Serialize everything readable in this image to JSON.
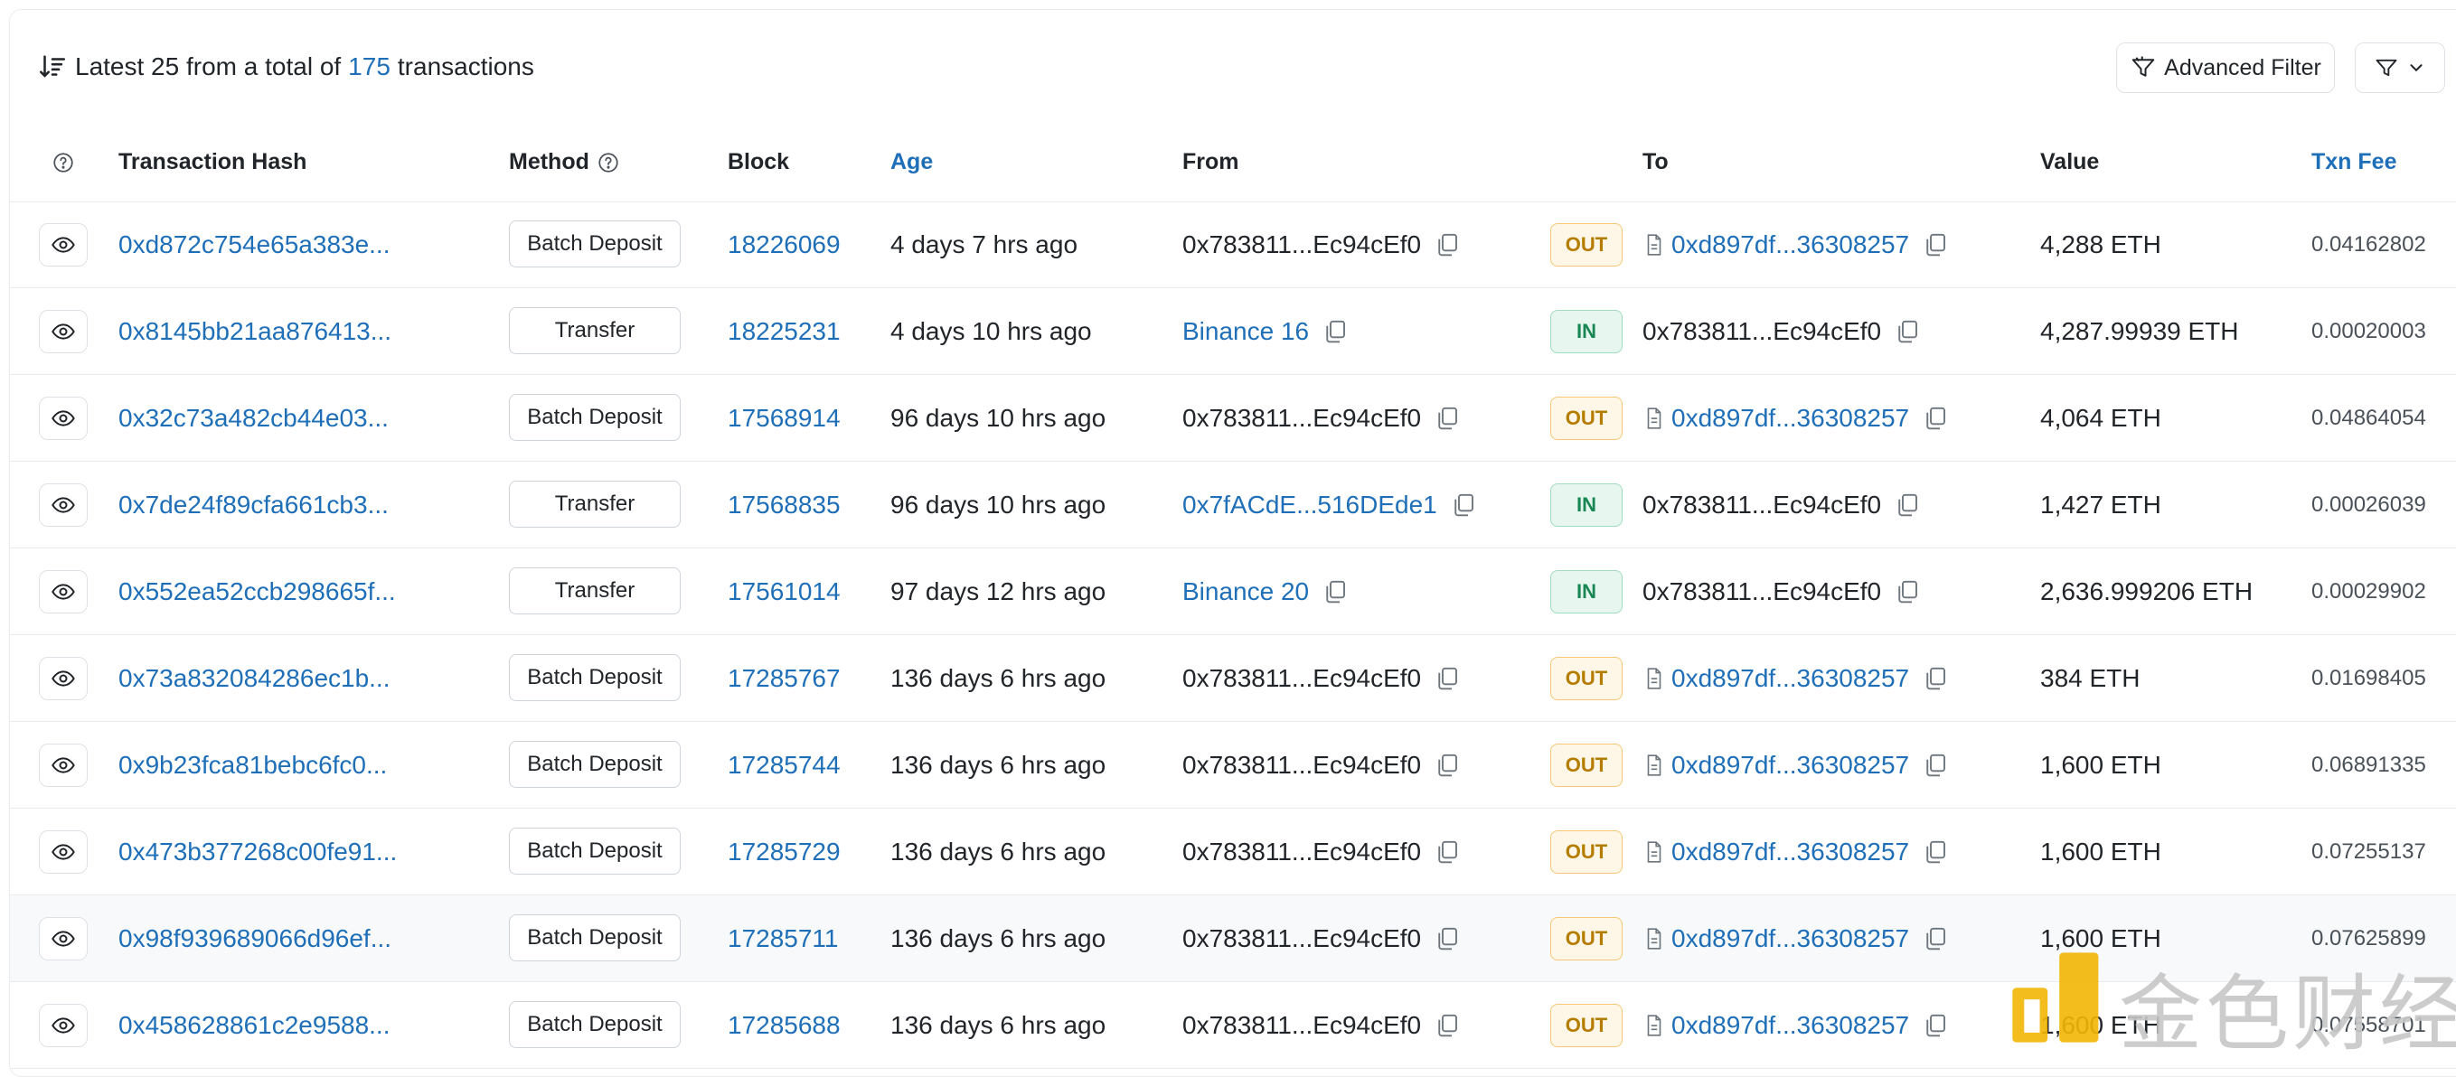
{
  "summary": {
    "prefix": "Latest 25 from a total of",
    "total": "175",
    "suffix": "transactions"
  },
  "toolbar": {
    "advanced_filter_label": "Advanced Filter"
  },
  "columns": {
    "hash": "Transaction Hash",
    "method": "Method",
    "block": "Block",
    "age": "Age",
    "from": "From",
    "to": "To",
    "value": "Value",
    "fee": "Txn Fee"
  },
  "colors": {
    "link": "#1e6fb8",
    "out_bg": "#fef6e6",
    "out_text": "#b47d00",
    "in_bg": "#e7f6ee",
    "in_text": "#198754"
  },
  "rows": [
    {
      "hash": "0xd872c754e65a383e...",
      "method": "Batch Deposit",
      "block": "18226069",
      "age": "4 days 7 hrs ago",
      "from": "0x783811...Ec94cEf0",
      "from_link": false,
      "dir": "OUT",
      "to": "0xd897df...36308257",
      "to_contract": true,
      "value": "4,288 ETH",
      "fee": "0.04162802"
    },
    {
      "hash": "0x8145bb21aa876413...",
      "method": "Transfer",
      "block": "18225231",
      "age": "4 days 10 hrs ago",
      "from": "Binance 16",
      "from_link": true,
      "dir": "IN",
      "to": "0x783811...Ec94cEf0",
      "to_contract": false,
      "value": "4,287.99939 ETH",
      "fee": "0.00020003"
    },
    {
      "hash": "0x32c73a482cb44e03...",
      "method": "Batch Deposit",
      "block": "17568914",
      "age": "96 days 10 hrs ago",
      "from": "0x783811...Ec94cEf0",
      "from_link": false,
      "dir": "OUT",
      "to": "0xd897df...36308257",
      "to_contract": true,
      "value": "4,064 ETH",
      "fee": "0.04864054"
    },
    {
      "hash": "0x7de24f89cfa661cb3...",
      "method": "Transfer",
      "block": "17568835",
      "age": "96 days 10 hrs ago",
      "from": "0x7fACdE...516DEde1",
      "from_link": true,
      "dir": "IN",
      "to": "0x783811...Ec94cEf0",
      "to_contract": false,
      "value": "1,427 ETH",
      "fee": "0.00026039"
    },
    {
      "hash": "0x552ea52ccb298665f...",
      "method": "Transfer",
      "block": "17561014",
      "age": "97 days 12 hrs ago",
      "from": "Binance 20",
      "from_link": true,
      "dir": "IN",
      "to": "0x783811...Ec94cEf0",
      "to_contract": false,
      "value": "2,636.999206 ETH",
      "fee": "0.00029902"
    },
    {
      "hash": "0x73a832084286ec1b...",
      "method": "Batch Deposit",
      "block": "17285767",
      "age": "136 days 6 hrs ago",
      "from": "0x783811...Ec94cEf0",
      "from_link": false,
      "dir": "OUT",
      "to": "0xd897df...36308257",
      "to_contract": true,
      "value": "384 ETH",
      "fee": "0.01698405"
    },
    {
      "hash": "0x9b23fca81bebc6fc0...",
      "method": "Batch Deposit",
      "block": "17285744",
      "age": "136 days 6 hrs ago",
      "from": "0x783811...Ec94cEf0",
      "from_link": false,
      "dir": "OUT",
      "to": "0xd897df...36308257",
      "to_contract": true,
      "value": "1,600 ETH",
      "fee": "0.06891335"
    },
    {
      "hash": "0x473b377268c00fe91...",
      "method": "Batch Deposit",
      "block": "17285729",
      "age": "136 days 6 hrs ago",
      "from": "0x783811...Ec94cEf0",
      "from_link": false,
      "dir": "OUT",
      "to": "0xd897df...36308257",
      "to_contract": true,
      "value": "1,600 ETH",
      "fee": "0.07255137"
    },
    {
      "hash": "0x98f939689066d96ef...",
      "method": "Batch Deposit",
      "block": "17285711",
      "age": "136 days 6 hrs ago",
      "from": "0x783811...Ec94cEf0",
      "from_link": false,
      "dir": "OUT",
      "to": "0xd897df...36308257",
      "to_contract": true,
      "value": "1,600 ETH",
      "fee": "0.07625899",
      "highlighted": true
    },
    {
      "hash": "0x458628861c2e9588...",
      "method": "Batch Deposit",
      "block": "17285688",
      "age": "136 days 6 hrs ago",
      "from": "0x783811...Ec94cEf0",
      "from_link": false,
      "dir": "OUT",
      "to": "0xd897df...36308257",
      "to_contract": true,
      "value": "1,600 ETH",
      "fee": "0.07558701"
    }
  ],
  "watermark": {
    "text": "金色财经",
    "logo_icon": "jinse-logo-icon"
  }
}
